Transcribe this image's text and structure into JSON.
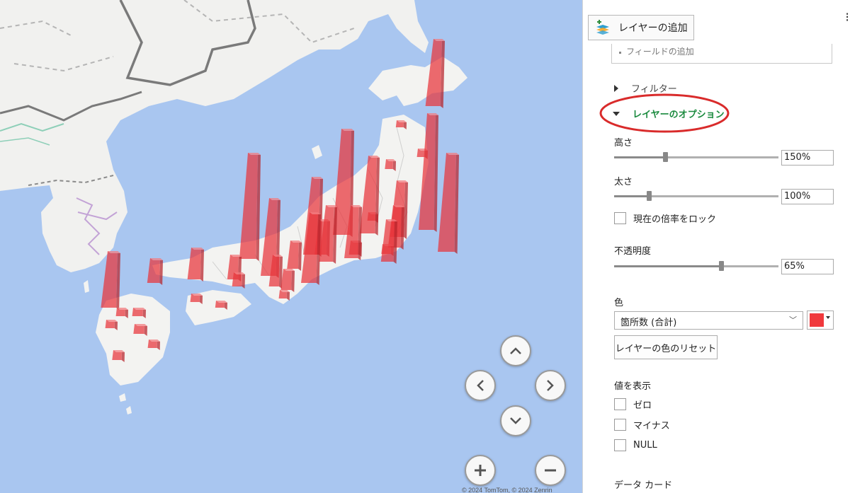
{
  "map": {
    "copyright": "© 2024 TomTom, © 2024 Zenrin",
    "bar_color": "#e8353b",
    "navigation": [
      {
        "name": "pan-up-button",
        "icon": "chevron-up-icon"
      },
      {
        "name": "pan-left-button",
        "icon": "chevron-left-icon"
      },
      {
        "name": "pan-right-button",
        "icon": "chevron-right-icon"
      },
      {
        "name": "pan-down-button",
        "icon": "chevron-down-icon"
      },
      {
        "name": "zoom-in-button",
        "icon": "plus-icon"
      },
      {
        "name": "zoom-out-button",
        "icon": "minus-icon"
      }
    ]
  },
  "panel": {
    "add_layer_label": "レイヤーの追加",
    "add_layer_icon": "layers-plus-icon",
    "field_add_label": "フィールドの追加",
    "filter_label": "フィルター",
    "layer_options_label": "レイヤーのオプション",
    "layer_options_color": "#1a8a3e",
    "highlight_circle_color": "#d92b2b",
    "height": {
      "label": "高さ",
      "value_text": "150%",
      "fraction": 0.31
    },
    "thickness": {
      "label": "太さ",
      "value_text": "100%",
      "fraction": 0.21
    },
    "lock_scale_label": "現在の倍率をロック",
    "opacity": {
      "label": "不透明度",
      "value_text": "65%",
      "fraction": 0.65
    },
    "color": {
      "label": "色",
      "selected": "箇所数 (合計)",
      "swatch": "#f0393c",
      "reset_label": "レイヤーの色のリセット"
    },
    "show_values": {
      "label": "値を表示",
      "options": [
        "ゼロ",
        "マイナス",
        "NULL"
      ]
    },
    "data_card_label": "データ カード"
  }
}
